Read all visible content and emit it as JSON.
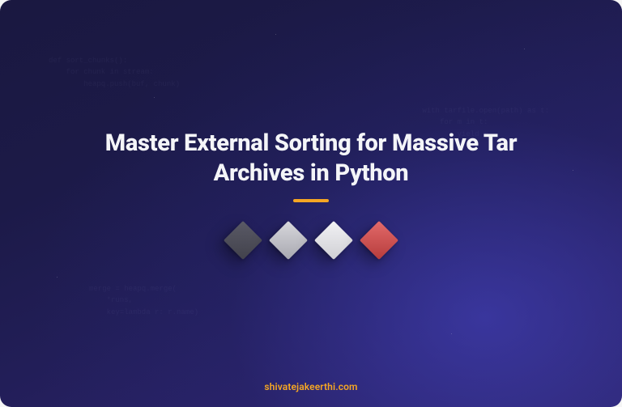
{
  "hero": {
    "title": "Master External Sorting for Massive Tar Archives in Python"
  },
  "footer": {
    "domain": "shivatejakeerthi.com"
  },
  "accent": {
    "underline_color": "#f5a623",
    "footer_color": "#f5a623"
  },
  "squares": [
    {
      "name": "square-dark-gray"
    },
    {
      "name": "square-light-gray"
    },
    {
      "name": "square-white"
    },
    {
      "name": "square-red"
    }
  ],
  "ghost_code": {
    "block1": "def sort_chunks():\n    for chunk in stream:\n        heapq.push(buf, chunk)",
    "block2": "with tarfile.open(path) as t:\n    for m in t:\n        yield m",
    "block3": "merge = heapq.merge(\n    *runs,\n    key=lambda r: r.name)"
  }
}
